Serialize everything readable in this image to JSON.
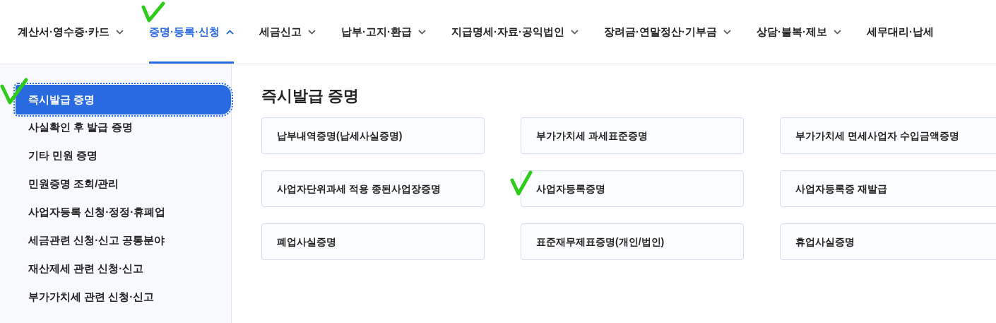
{
  "nav": {
    "items": [
      {
        "label": "계산서·영수증·카드",
        "selected": false
      },
      {
        "label": "증명·등록·신청",
        "selected": true
      },
      {
        "label": "세금신고",
        "selected": false
      },
      {
        "label": "납부·고지·환급",
        "selected": false
      },
      {
        "label": "지급명세·자료·공익법인",
        "selected": false
      },
      {
        "label": "장려금·연말정산·기부금",
        "selected": false
      },
      {
        "label": "상담·불복·제보",
        "selected": false
      },
      {
        "label": "세무대리·납세",
        "selected": false
      }
    ]
  },
  "sidebar": {
    "items": [
      {
        "label": "즉시발급 증명",
        "selected": true
      },
      {
        "label": "사실확인 후 발급 증명",
        "selected": false
      },
      {
        "label": "기타 민원 증명",
        "selected": false
      },
      {
        "label": "민원증명 조회/관리",
        "selected": false
      },
      {
        "label": "사업자등록 신청·정정·휴폐업",
        "selected": false
      },
      {
        "label": "세금관련 신청·신고 공통분야",
        "selected": false
      },
      {
        "label": "재산제세 관련 신청·신고",
        "selected": false
      },
      {
        "label": "부가가치세 관련 신청·신고",
        "selected": false
      }
    ]
  },
  "content": {
    "title": "즉시발급 증명",
    "cards": [
      "납부내역증명(납세사실증명)",
      "부가가치세 과세표준증명",
      "부가가치세 면세사업자 수입금액증명",
      "사업자단위과세 적용 종된사업장증명",
      "사업자등록증명",
      "사업자등록증 재발급",
      "폐업사실증명",
      "표준재무제표증명(개인/법인)",
      "휴업사실증명"
    ]
  }
}
